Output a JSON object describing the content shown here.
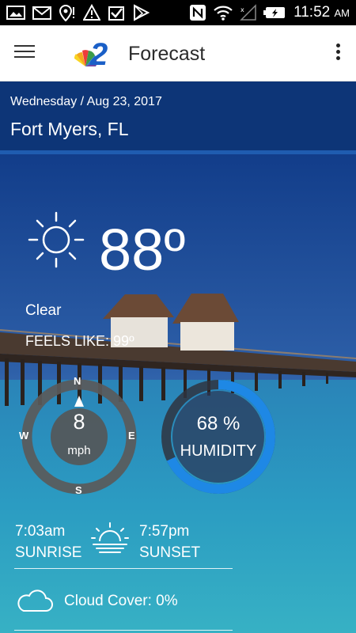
{
  "status_bar": {
    "time": "11:52",
    "ampm": "AM",
    "icons": [
      "gallery-icon",
      "gmail-icon",
      "location-alert-icon",
      "warning-icon",
      "check-app-icon",
      "play-store-icon",
      "nfc-icon",
      "wifi-icon",
      "signal-icon",
      "battery-icon"
    ]
  },
  "app_bar": {
    "title": "Forecast",
    "logo": "NBC 2"
  },
  "location": {
    "date": "Wednesday / Aug 23, 2017",
    "city": "Fort Myers, FL"
  },
  "current": {
    "temp": "88º",
    "condition": "Clear",
    "feels_like": "FEELS LIKE: 99º"
  },
  "wind": {
    "speed": "8",
    "unit": "mph",
    "north": "N",
    "south": "S",
    "east": "E",
    "west": "W"
  },
  "humidity": {
    "value": "68 %",
    "label": "HUMIDITY",
    "fraction": 0.68
  },
  "sun": {
    "sunrise_time": "7:03am",
    "sunrise_label": "SUNRISE",
    "sunset_time": "7:57pm",
    "sunset_label": "SUNSET"
  },
  "cloud": {
    "text": "Cloud Cover: 0%"
  },
  "colors": {
    "accent": "#1e88e5",
    "header": "#0e3678",
    "gauge_ring": "#555555"
  }
}
